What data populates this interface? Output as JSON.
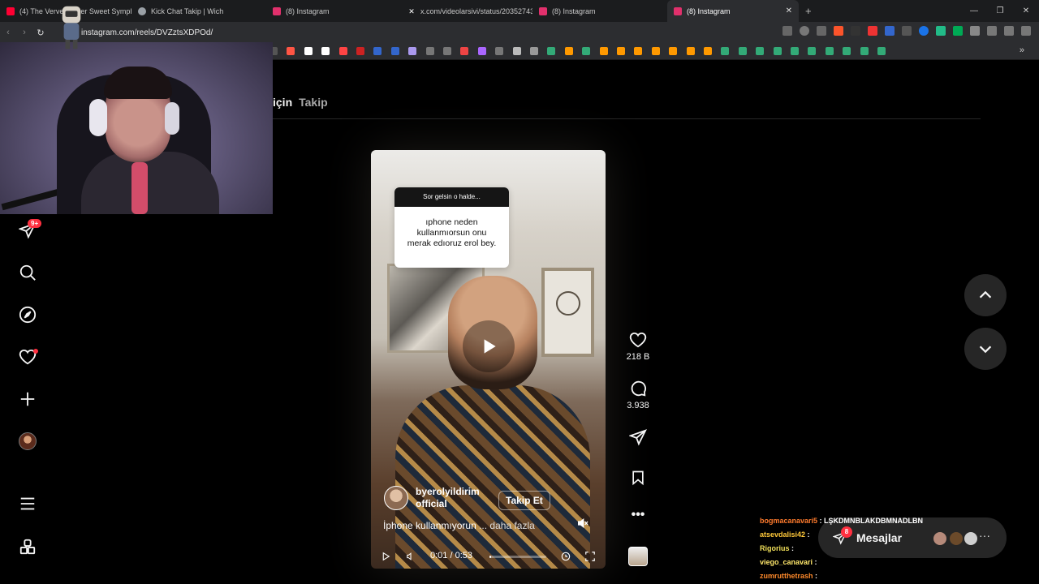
{
  "browser": {
    "tabs": [
      {
        "title": "(4) The Verve - Bitter Sweet Symphony",
        "icon": "youtube-icon",
        "color": "#ff0033"
      },
      {
        "title": "Kick Chat Takip | Wich",
        "icon": "globe-icon",
        "color": "#9aa0a6"
      },
      {
        "title": "(8) Instagram",
        "icon": "instagram-icon",
        "color": "#e1306c"
      },
      {
        "title": "x.com/videolarsivi/status/203527434",
        "icon": "x-icon",
        "color": "#ffffff"
      },
      {
        "title": "(8) Instagram",
        "icon": "instagram-icon",
        "color": "#e1306c"
      },
      {
        "title": "(8) Instagram",
        "icon": "instagram-icon",
        "color": "#e1306c"
      }
    ],
    "url": "instagram.com/reels/DVZztsXDPOd/"
  },
  "sidebar": {
    "notifications_badge": "9+"
  },
  "feed_tabs": {
    "for_you": "için",
    "following": "Takip"
  },
  "reel": {
    "question_header": "Sor gelsin o halde...",
    "question_text": "ıphone neden kullanmıorsun onu merak edıoruz erol bey.",
    "author": "byerolyildirim official",
    "follow_label": "Takip Et",
    "caption": "İphone kullanmıyorun",
    "caption_more": "... daha fazla",
    "time": "0:01 / 0:53",
    "progress": 0.03
  },
  "actions": {
    "likes": "218 B",
    "comments": "3.938"
  },
  "messages": {
    "label": "Mesajlar",
    "count": "8"
  },
  "chat": [
    {
      "user": "bogmacanavari5",
      "text": "LŞKDMNBLAKDBMNADLBN"
    },
    {
      "user": "atsevdalisi42",
      "text": ""
    },
    {
      "user": "Rigorius",
      "text": ""
    },
    {
      "user": "viego_canavari",
      "text": ""
    },
    {
      "user": "zumrutthetrash",
      "text": ""
    }
  ],
  "colors": {
    "accent_red": "#ff3040",
    "background": "#000000"
  }
}
